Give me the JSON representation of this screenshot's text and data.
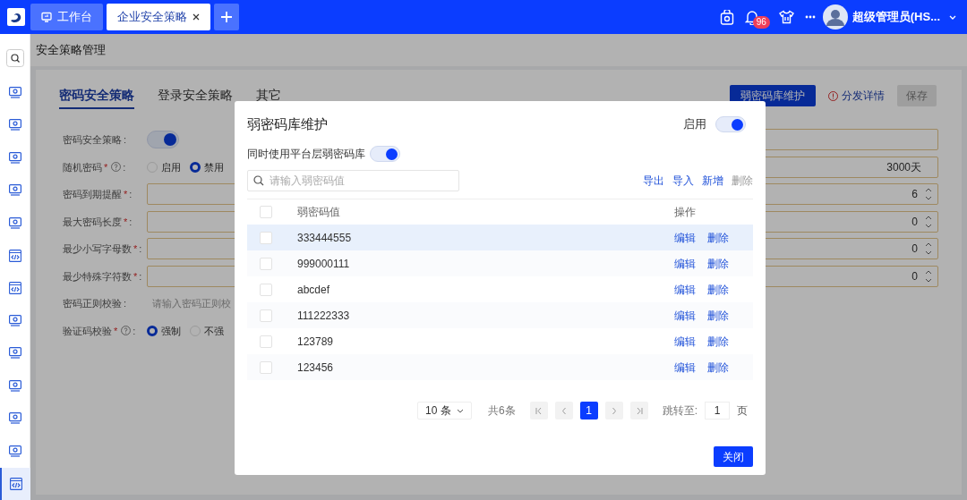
{
  "topbar": {
    "tabs": [
      {
        "label": "工作台",
        "selected": false,
        "closable": false
      },
      {
        "label": "企业安全策略",
        "selected": true,
        "closable": true
      }
    ],
    "notification_count": "96",
    "user_name": "超级管理员(HS..."
  },
  "sidebar": {
    "items": [
      {
        "kind": "search",
        "selected": false
      },
      {
        "kind": "monitor",
        "selected": false
      },
      {
        "kind": "monitor",
        "selected": false
      },
      {
        "kind": "monitor",
        "selected": false
      },
      {
        "kind": "monitor",
        "selected": false
      },
      {
        "kind": "monitor",
        "selected": false
      },
      {
        "kind": "code",
        "selected": false
      },
      {
        "kind": "code",
        "selected": false
      },
      {
        "kind": "monitor",
        "selected": false
      },
      {
        "kind": "monitor",
        "selected": false
      },
      {
        "kind": "monitor",
        "selected": false
      },
      {
        "kind": "monitor",
        "selected": false
      },
      {
        "kind": "monitor",
        "selected": false
      },
      {
        "kind": "code",
        "selected": true
      }
    ]
  },
  "page": {
    "title": "安全策略管理",
    "tabs": [
      {
        "label": "密码安全策略",
        "selected": true
      },
      {
        "label": "登录安全策略",
        "selected": false
      },
      {
        "label": "其它",
        "selected": false
      }
    ],
    "actions": {
      "primary": "弱密码库维护",
      "link": "分发详情",
      "save": "保存",
      "save_disabled": true
    },
    "form": [
      {
        "label": "密码安全策略",
        "colon": ":",
        "kind": "toggle",
        "on": true,
        "side_field": true
      },
      {
        "label": "随机密码",
        "required_mark": "*",
        "help": true,
        "colon": ":",
        "kind": "radio",
        "options": [
          {
            "label": "启用",
            "selected": false
          },
          {
            "label": "禁用",
            "selected": true
          }
        ],
        "side_value": "3000天"
      },
      {
        "label": "密码到期提醒",
        "required_mark": "*",
        "colon": ":",
        "kind": "number",
        "value": "6"
      },
      {
        "label": "最大密码长度",
        "required_mark": "*",
        "colon": ":",
        "kind": "number",
        "value": "0"
      },
      {
        "label": "最少小写字母数",
        "required_mark": "*",
        "colon": ":",
        "kind": "number",
        "value": "0"
      },
      {
        "label": "最少特殊字符数",
        "required_mark": "*",
        "colon": ":",
        "kind": "number",
        "value": "0"
      },
      {
        "label": "密码正则校验",
        "colon": ":",
        "kind": "text",
        "placeholder": "请输入密码正则校"
      },
      {
        "label": "验证码校验",
        "required_mark": "*",
        "help": true,
        "colon": ":",
        "kind": "radio",
        "options": [
          {
            "label": "强制",
            "selected": true
          },
          {
            "label": "不强",
            "selected": false
          }
        ]
      }
    ]
  },
  "modal": {
    "title": "弱密码库维护",
    "enable_label": "启用",
    "enabled": true,
    "platform_label": "同时使用平台层弱密码库",
    "platform_on": true,
    "search": {
      "placeholder": "请输入弱密码值"
    },
    "toolbar": [
      {
        "label": "导出",
        "disabled": false
      },
      {
        "label": "导入",
        "disabled": false
      },
      {
        "label": "新增",
        "disabled": false
      },
      {
        "label": "删除",
        "disabled": true
      }
    ],
    "table": {
      "columns": [
        "弱密码值",
        "操作"
      ],
      "select_all_checked": false,
      "rows": [
        {
          "value": "333444555",
          "checked": false,
          "highlighted": true,
          "actions": [
            "编辑",
            "删除"
          ]
        },
        {
          "value": "999000111",
          "checked": false,
          "highlighted": false,
          "actions": [
            "编辑",
            "删除"
          ]
        },
        {
          "value": "abcdef",
          "checked": false,
          "highlighted": false,
          "actions": [
            "编辑",
            "删除"
          ]
        },
        {
          "value": "111222333",
          "checked": false,
          "highlighted": false,
          "actions": [
            "编辑",
            "删除"
          ]
        },
        {
          "value": "123789",
          "checked": false,
          "highlighted": false,
          "actions": [
            "编辑",
            "删除"
          ]
        },
        {
          "value": "123456",
          "checked": false,
          "highlighted": false,
          "actions": [
            "编辑",
            "删除"
          ]
        }
      ]
    },
    "pagination": {
      "page_size": "10 条",
      "total": "共6条",
      "pages": [
        {
          "label": "1",
          "selected": true
        }
      ],
      "jump_label": "跳转至:",
      "jump_value": "1",
      "page_unit": "页"
    },
    "close": "关闭"
  }
}
